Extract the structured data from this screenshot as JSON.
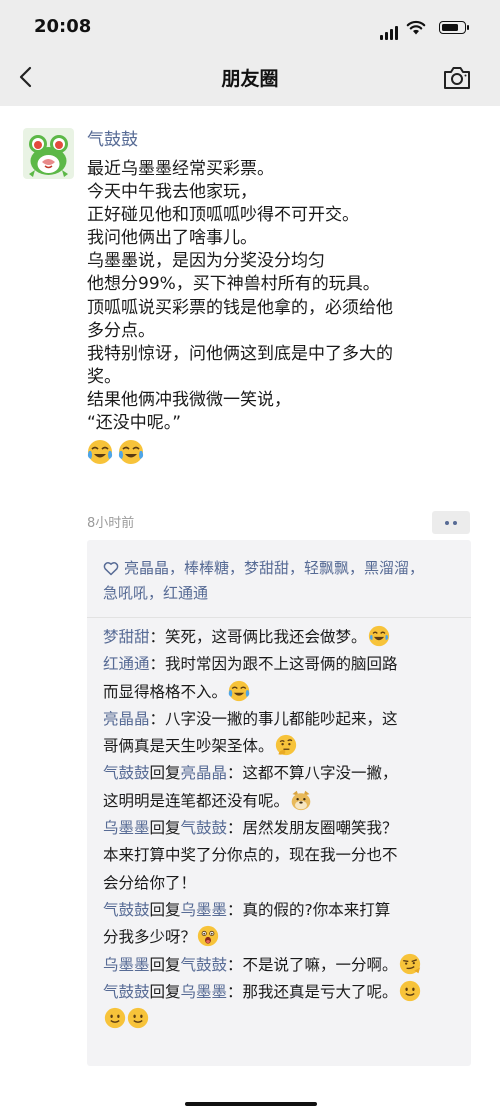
{
  "status_bar": {
    "time": "20:08",
    "battery_level": 0.85
  },
  "nav": {
    "title": "朋友圈",
    "back_icon": "chevron-left-icon",
    "camera_icon": "camera-icon"
  },
  "post": {
    "author": "气鼓鼓",
    "avatar_icon": "frog-avatar",
    "lines": [
      "最近乌墨墨经常买彩票。",
      "今天中午我去他家玩，",
      "正好碰见他和顶呱呱吵得不可开交。",
      "我问他俩出了啥事儿。",
      "乌墨墨说，是因为分奖没分均匀",
      "他想分99%，买下神兽村所有的玩具。",
      "顶呱呱说买彩票的钱是他拿的，必须给他",
      "多分点。",
      "我特别惊讶，问他俩这到底是中了多大的",
      "奖。",
      "结果他俩冲我微微一笑说，",
      "“还没中呢。”"
    ],
    "trailing_emojis": [
      "crying-laughing-emoji",
      "crying-laughing-emoji"
    ],
    "time": "8小时前",
    "more_icon": "two-dots-icon"
  },
  "likes": {
    "heart_icon": "heart-outline-icon",
    "line1": "亮晶晶，棒棒糖，梦甜甜，轻飘飘，黑溜溜，",
    "line2": "急吼吼，红通通"
  },
  "comments": {
    "c1": {
      "name": "梦甜甜",
      "text": "：笑死，这哥俩比我还会做梦。",
      "emoji": "tears-of-joy-emoji"
    },
    "c2": {
      "name": "红通通",
      "text1": "：我时常因为跟不上这哥俩的脑回路",
      "text2": "而显得格格不入。",
      "emoji": "crying-laughing-emoji"
    },
    "c3": {
      "name": "亮晶晶",
      "text1": "：八字没一撇的事儿都能吵起来，这",
      "text2": "哥俩真是天生吵架圣体。",
      "emoji": "thinking-face-emoji"
    },
    "c4": {
      "name": "气鼓鼓",
      "reply": "回复",
      "target": "亮晶晶",
      "text1": "：这都不算八字没一撇，",
      "text2": "这明明是连笔都还没有呢。",
      "emoji": "doge-emoji"
    },
    "c5": {
      "name": "乌墨墨",
      "reply": "回复",
      "target": "气鼓鼓",
      "text1": "：居然发朋友圈嘲笑我？",
      "text2": "本来打算中奖了分你点的，现在我一分也不",
      "text3": "会分给你了！"
    },
    "c6": {
      "name": "气鼓鼓",
      "reply": "回复",
      "target": "乌墨墨",
      "text1": "：真的假的?你本来打算",
      "text2": "分我多少呀？",
      "emoji": "surprised-face-emoji"
    },
    "c7": {
      "name": "乌墨墨",
      "reply": "回复",
      "target": "气鼓鼓",
      "text": "：不是说了嘛，一分啊。",
      "emoji": "smirk-face-emoji"
    },
    "c8": {
      "name": "气鼓鼓",
      "reply": "回复",
      "target": "乌墨墨",
      "text": "：那我还真是亏大了呢。",
      "emojis": [
        "smile-face-emoji",
        "smile-face-emoji",
        "smile-face-emoji"
      ]
    }
  }
}
